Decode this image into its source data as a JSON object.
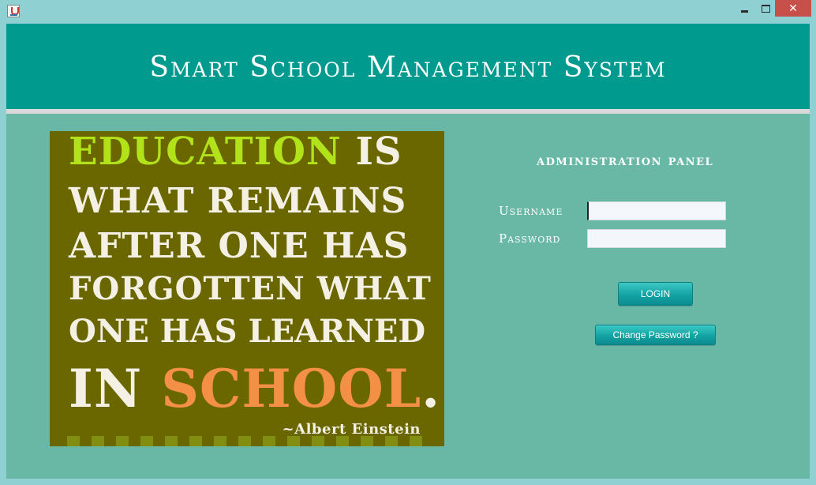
{
  "window": {
    "close_glyph": "✕",
    "icons": {
      "app": "java-cup-icon",
      "minimize": "minimize-icon",
      "maximize": "maximize-icon",
      "close": "close-icon"
    }
  },
  "header": {
    "title": "Smart School Management System"
  },
  "poster": {
    "line1_highlight": "Education",
    "line1_rest": " is",
    "line2": "what remains",
    "line3": "after one has",
    "line4": "forgotten what",
    "line5": "one has learned",
    "line6_start": "in ",
    "line6_highlight": "school",
    "line6_end": ".",
    "author": "~Albert Einstein",
    "colors": {
      "background": "#6a6600",
      "highlight_green": "#b1e21a",
      "highlight_orange": "#f39046"
    }
  },
  "login_panel": {
    "title": "administration panel",
    "username_label": "Username",
    "password_label": "Password",
    "username_value": "",
    "password_value": "",
    "login_button": "LOGIN",
    "change_password_button": "Change Password ?"
  },
  "colors": {
    "header": "#009a8e",
    "panel_bg": "#69b7a5",
    "button": "#13a3a3"
  }
}
